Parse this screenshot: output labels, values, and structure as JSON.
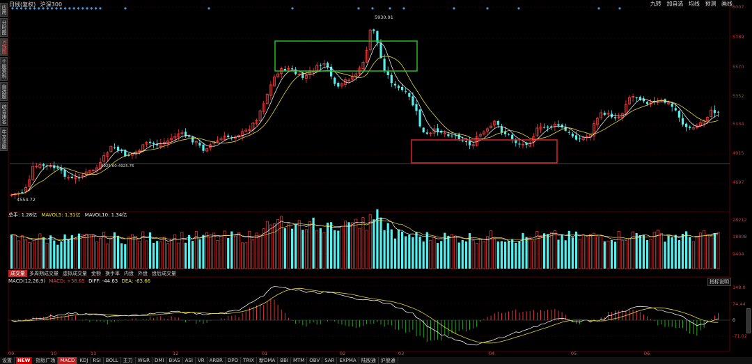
{
  "top_bar": {
    "title_parts": [
      "日线(复权)",
      "沪深300"
    ],
    "right_buttons": [
      "九转",
      "加自选",
      "均线",
      "预测",
      "画线"
    ]
  },
  "left_rail": {
    "tabs": [
      {
        "label": "应用",
        "active": false
      },
      {
        "label": "分时图",
        "active": false
      },
      {
        "label": "K线图",
        "active": true
      },
      {
        "label": "个股资料",
        "active": false
      },
      {
        "label": "自选股",
        "active": false
      },
      {
        "label": "综合排名",
        "active": false
      },
      {
        "label": "牛叉诊股",
        "active": false
      }
    ]
  },
  "price_axis": {
    "ticks": [
      "6007",
      "5789",
      "5570",
      "5352",
      "5134",
      "4915",
      "4697"
    ]
  },
  "price_annotations": {
    "high_label": "5930.91",
    "low_label": "4554.72",
    "line_label": "4925.60-4925.76"
  },
  "volume": {
    "legend": {
      "vol": "总手: 1.28亿",
      "ma5": "MAVOL5: 1.31亿",
      "ma10": "MAVOL10: 1.34亿"
    },
    "ticks": [
      "28212",
      "18808",
      "9404"
    ],
    "tabs": [
      {
        "label": "成交量",
        "active": true
      },
      {
        "label": "多周期成交量",
        "active": false
      },
      {
        "label": "虚拟成交量",
        "active": false
      },
      {
        "label": "金额",
        "active": false
      },
      {
        "label": "换手率",
        "active": false
      },
      {
        "label": "内盘",
        "active": false
      },
      {
        "label": "外盘",
        "active": false
      },
      {
        "label": "盘后成交量",
        "active": false
      }
    ]
  },
  "macd": {
    "legend": {
      "name": "MACD(12,26,9)",
      "macd": "MACD: +38.65",
      "diff": "DIFF: -44.63",
      "dea": "DEA: -63.66"
    },
    "explain": "指标说明",
    "ticks": [
      "148.0",
      "74.44",
      "0",
      "-71.02"
    ]
  },
  "time_axis": {
    "labels": [
      "09",
      "10",
      "11",
      "12",
      "01",
      "02",
      "03",
      "04",
      "05",
      "06"
    ]
  },
  "bottom_tabs": [
    {
      "label": "设置",
      "type": "normal"
    },
    {
      "label": "NEW",
      "type": "new"
    },
    {
      "label": "指标广场",
      "type": "normal"
    },
    {
      "label": "MACD",
      "type": "active"
    },
    {
      "label": "KDJ",
      "type": "normal"
    },
    {
      "label": "RSI",
      "type": "normal"
    },
    {
      "label": "BOLL",
      "type": "normal"
    },
    {
      "label": "主力",
      "type": "normal"
    },
    {
      "label": "W&R",
      "type": "normal"
    },
    {
      "label": "DMI",
      "type": "normal"
    },
    {
      "label": "BIAS",
      "type": "normal"
    },
    {
      "label": "ASI",
      "type": "normal"
    },
    {
      "label": "VR",
      "type": "normal"
    },
    {
      "label": "ARBR",
      "type": "normal"
    },
    {
      "label": "DPO",
      "type": "normal"
    },
    {
      "label": "TRIX",
      "type": "normal"
    },
    {
      "label": "新DMA",
      "type": "normal"
    },
    {
      "label": "BBI",
      "type": "normal"
    },
    {
      "label": "MTM",
      "type": "normal"
    },
    {
      "label": "OBV",
      "type": "normal"
    },
    {
      "label": "SAR",
      "type": "normal"
    },
    {
      "label": "EXPMA",
      "type": "normal"
    },
    {
      "label": "陆股通",
      "type": "normal"
    },
    {
      "label": "沪股通",
      "type": "normal"
    }
  ],
  "colors": {
    "up": "#ff3c3c",
    "down": "#54f0f0",
    "ma_white": "#e8e8e8",
    "ma_yellow": "#e8d840",
    "green_box": "#22c022",
    "red_box": "#e02020",
    "diamond": "#3aa0e8",
    "grid": "#5a0000"
  }
}
